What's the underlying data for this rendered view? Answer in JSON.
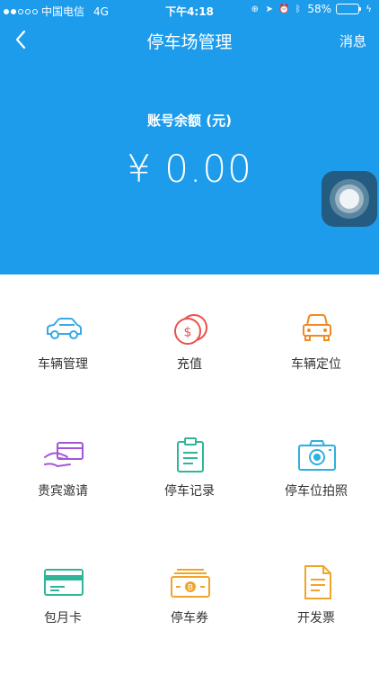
{
  "status_bar": {
    "carrier": "中国电信",
    "network": "4G",
    "time": "下午4:18",
    "battery": "58%",
    "battery_level": 0.58
  },
  "nav": {
    "back_icon": "chevron-left-icon",
    "title": "停车场管理",
    "message_label": "消息"
  },
  "balance": {
    "label": "账号余额 (元)",
    "amount": "¥ 0.00"
  },
  "colors": {
    "header_bg": "#1e9cec",
    "blue": "#3aa7e6",
    "red": "#e8514a",
    "orange": "#f08a24",
    "purple": "#a355d9",
    "green": "#2fb69a",
    "cyan": "#2fb0e0",
    "gold": "#f0a52a"
  },
  "menu": [
    {
      "label": "车辆管理",
      "icon": "car-icon"
    },
    {
      "label": "充值",
      "icon": "coin-icon"
    },
    {
      "label": "车辆定位",
      "icon": "car-front-icon"
    },
    {
      "label": "贵宾邀请",
      "icon": "vip-card-icon"
    },
    {
      "label": "停车记录",
      "icon": "clipboard-icon"
    },
    {
      "label": "停车位拍照",
      "icon": "camera-icon"
    },
    {
      "label": "包月卡",
      "icon": "card-icon"
    },
    {
      "label": "停车券",
      "icon": "coupon-icon"
    },
    {
      "label": "开发票",
      "icon": "invoice-icon"
    }
  ]
}
